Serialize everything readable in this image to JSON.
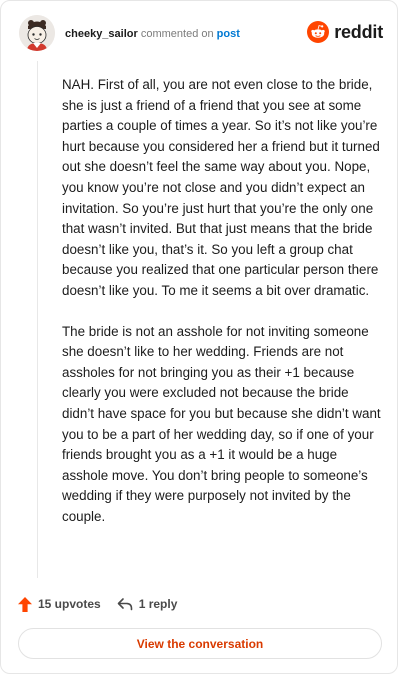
{
  "header": {
    "username": "cheeky_sailor",
    "action_text": "commented on",
    "post_link": "post",
    "brand": "reddit"
  },
  "comment": {
    "paragraphs": [
      "NAH. First of all, you are not even close to the bride, she is just a friend of a friend that you see at some parties a couple of times a year. So it’s not like you’re hurt because you considered her a friend but it turned out she doesn’t feel the same way about you. Nope, you know you’re not close and you didn’t expect an invitation. So you’re just hurt that you’re the only one that wasn’t invited. But that just means that the bride doesn’t like you, that’s it. So you left a group chat because you realized that one particular person there doesn’t like you. To me it seems a bit over dramatic.",
      "The bride is not an asshole for not inviting someone she doesn’t like to her wedding. Friends are not assholes for not bringing you as their +1 because clearly you were excluded not because the bride didn’t have space for you but because she didn’t want you to be a part of her wedding day, so if one of your friends brought you as a +1 it would be a huge asshole move. You don’t bring people to someone’s wedding if they were purposely not invited by the couple."
    ]
  },
  "actions": {
    "upvotes_label": "15 upvotes",
    "reply_label": "1 reply"
  },
  "footer": {
    "view_conversation_label": "View the conversation"
  },
  "icons": {
    "upvote": "upvote-arrow-icon",
    "reply": "reply-arrow-icon",
    "brand": "reddit-snoo-icon",
    "avatar": "user-avatar"
  },
  "colors": {
    "upvote": "#ff4500",
    "brand": "#ff4500",
    "link": "#0079d3",
    "button_text": "#d93a00"
  }
}
